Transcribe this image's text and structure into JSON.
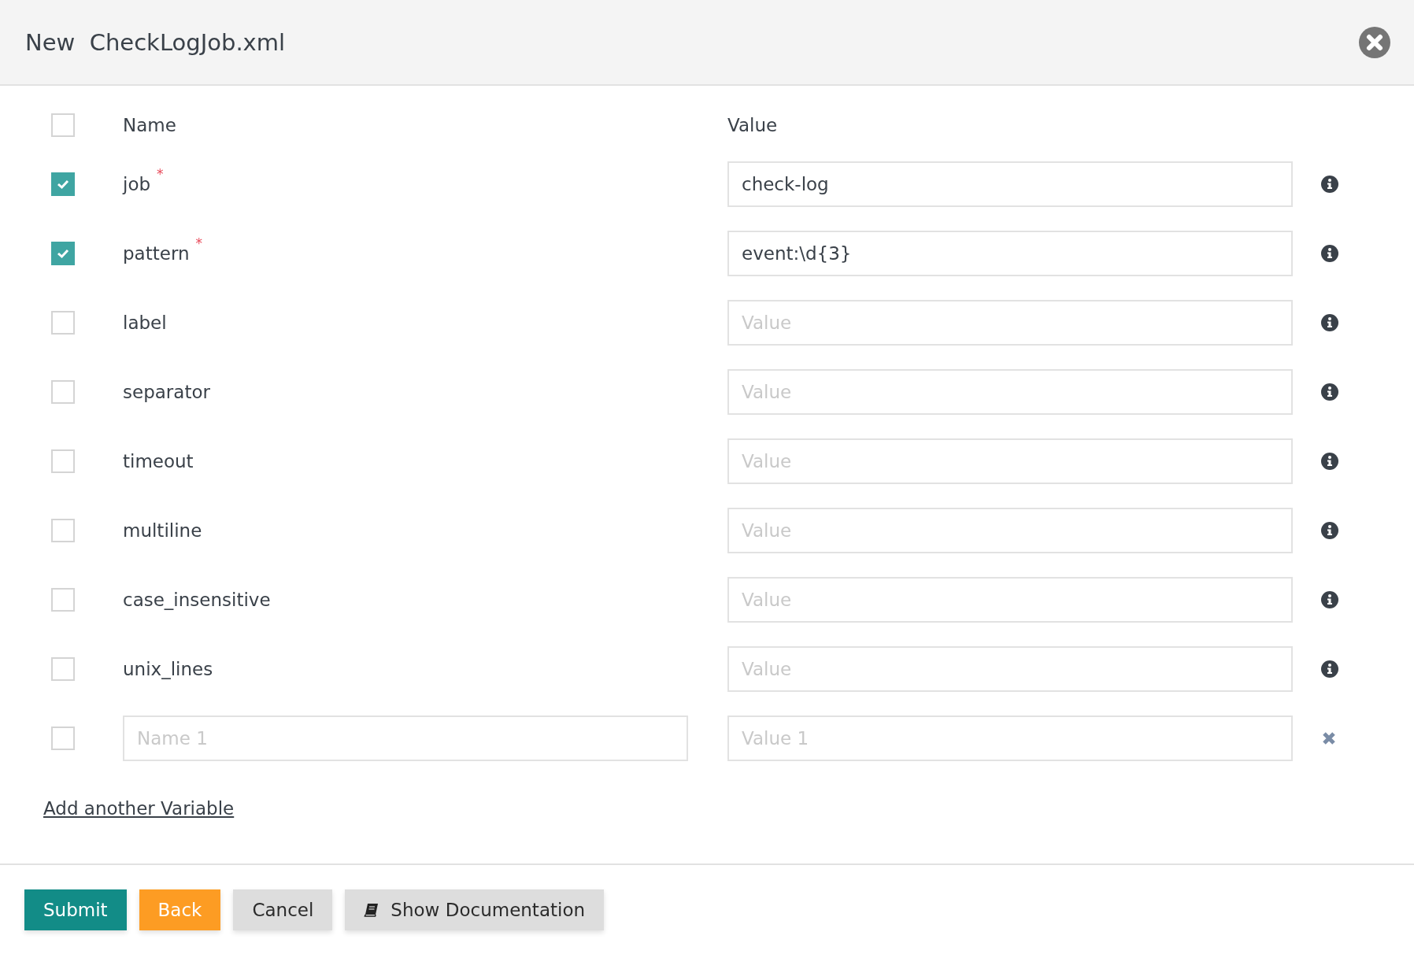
{
  "dialog": {
    "title_prefix": "New",
    "title": "CheckLogJob.xml"
  },
  "table": {
    "select_all_checked": false,
    "columns": [
      "Name",
      "Value"
    ],
    "rows": [
      {
        "kind": "param",
        "name": "job",
        "required_mark": "*",
        "checked": true,
        "value": "check-log"
      },
      {
        "kind": "param",
        "name": "pattern",
        "required_mark": "*",
        "checked": true,
        "value": "event:\\d{3}"
      },
      {
        "kind": "param",
        "name": "label",
        "checked": false,
        "placeholder": "Value"
      },
      {
        "kind": "param",
        "name": "separator",
        "checked": false,
        "placeholder": "Value"
      },
      {
        "kind": "param",
        "name": "timeout",
        "checked": false,
        "placeholder": "Value"
      },
      {
        "kind": "param",
        "name": "multiline",
        "checked": false,
        "placeholder": "Value"
      },
      {
        "kind": "param",
        "name": "case_insensitive",
        "checked": false,
        "placeholder": "Value"
      },
      {
        "kind": "param",
        "name": "unix_lines",
        "checked": false,
        "placeholder": "Value"
      },
      {
        "kind": "custom",
        "checked": false,
        "name_placeholder": "Name 1",
        "placeholder": "Value 1"
      }
    ]
  },
  "add_link": "Add another Variable",
  "buttons": [
    {
      "kind": "primary",
      "label": "Submit"
    },
    {
      "kind": "warning",
      "label": "Back"
    },
    {
      "kind": "default",
      "label": "Cancel"
    },
    {
      "kind": "docs",
      "label": "Show Documentation"
    }
  ]
}
